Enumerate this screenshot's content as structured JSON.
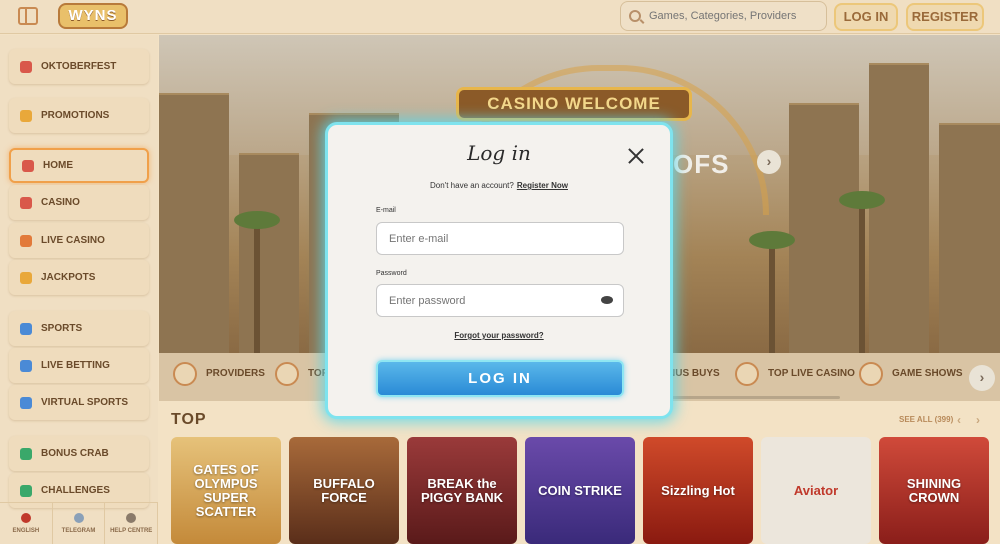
{
  "header": {
    "logo_text": "WYNS",
    "search_placeholder": "Games, Categories, Providers",
    "login_label": "LOG IN",
    "register_label": "REGISTER"
  },
  "sidebar": {
    "items": [
      {
        "label": "OKTOBERFEST",
        "icon": "beer-icon",
        "color": "#d9584a"
      },
      {
        "label": "PROMOTIONS",
        "icon": "gift-icon",
        "color": "#e9a83a"
      },
      {
        "label": "HOME",
        "icon": "home-icon",
        "color": "#d9584a"
      },
      {
        "label": "CASINO",
        "icon": "slot-machine-icon",
        "color": "#d9584a"
      },
      {
        "label": "LIVE CASINO",
        "icon": "cards-icon",
        "color": "#e27a3a"
      },
      {
        "label": "JACKPOTS",
        "icon": "coins-icon",
        "color": "#e9a83a"
      },
      {
        "label": "SPORTS",
        "icon": "ball-icon",
        "color": "#4a8ad6"
      },
      {
        "label": "LIVE BETTING",
        "icon": "live-icon",
        "color": "#4a8ad6"
      },
      {
        "label": "VIRTUAL SPORTS",
        "icon": "monitor-icon",
        "color": "#4a8ad6"
      },
      {
        "label": "BONUS CRAB",
        "icon": "crab-icon",
        "color": "#3aa86a"
      },
      {
        "label": "CHALLENGES",
        "icon": "trophy-icon",
        "color": "#3aa86a"
      }
    ],
    "footer": [
      {
        "label": "ENGLISH",
        "icon": "uk-flag-icon",
        "color": "#c0392b"
      },
      {
        "label": "TELEGRAM",
        "icon": "telegram-icon",
        "color": "#8aa0b8"
      },
      {
        "label": "HELP CENTRE",
        "icon": "help-icon",
        "color": "#8a7a6a"
      }
    ]
  },
  "hero": {
    "sign_text": "CASINO WELCOME BONUS",
    "overlay_text": "OFS",
    "arrow": "›"
  },
  "categories": [
    {
      "label": "PROVIDERS"
    },
    {
      "label": "TOP"
    },
    {
      "label": "NUS BUYS"
    },
    {
      "label": "TOP LIVE CASINO"
    },
    {
      "label": "GAME SHOWS"
    }
  ],
  "top_section": {
    "title": "TOP",
    "see_all": "SEE ALL (399)",
    "games": [
      {
        "title": "GATES OF OLYMPUS SUPER SCATTER",
        "bg": "#d9a857"
      },
      {
        "title": "BUFFALO FORCE",
        "bg": "#8a4a2a"
      },
      {
        "title": "BREAK the PIGGY BANK",
        "bg": "#7a2a2a"
      },
      {
        "title": "COIN STRIKE",
        "bg": "#5a3a9a"
      },
      {
        "title": "Sizzling Hot",
        "bg": "#b8301e"
      },
      {
        "title": "Aviator",
        "bg": "#e8e4dc"
      },
      {
        "title": "SHINING CROWN",
        "bg": "#c0392b"
      }
    ]
  },
  "modal": {
    "title": "Log in",
    "no_account_text": "Don't have an account?",
    "register_link": "Register Now",
    "email_label": "E-mail",
    "email_placeholder": "Enter e-mail",
    "password_label": "Password",
    "password_placeholder": "Enter password",
    "forgot_link": "Forgot your password?",
    "submit_label": "LOG IN"
  },
  "colors": {
    "accent": "#7fe3ee",
    "button": "#2a8ad6",
    "background": "#f3e2c5"
  }
}
